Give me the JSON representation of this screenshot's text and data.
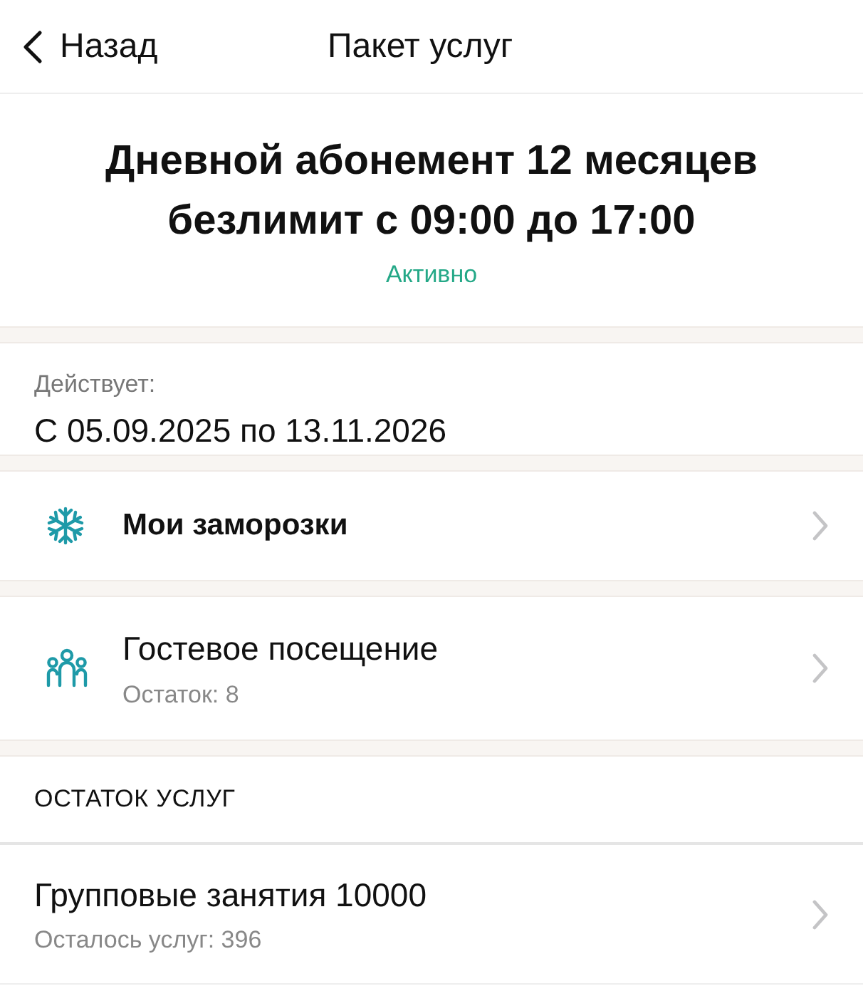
{
  "nav": {
    "back": "Назад",
    "title": "Пакет услуг"
  },
  "plan": {
    "title": "Дневной абонемент 12 месяцев безлимит с 09:00 до 17:00",
    "status": "Активно"
  },
  "validity": {
    "label": "Действует:",
    "value": "С 05.09.2025 по 13.11.2026"
  },
  "menu": [
    {
      "kind": "freeze",
      "title": "Мои заморозки"
    },
    {
      "kind": "guests",
      "title": "Гостевое посещение",
      "subtitle": "Остаток: 8"
    }
  ],
  "services": {
    "header": "ОСТАТОК УСЛУГ",
    "items": [
      {
        "title": "Групповые занятия 10000",
        "subtitle": "Осталось услуг: 396"
      }
    ]
  }
}
